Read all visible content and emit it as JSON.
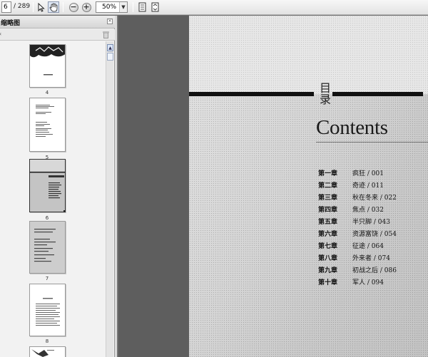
{
  "toolbar": {
    "page_current": "6",
    "page_total": "/ 289",
    "zoom": "50%",
    "icons": [
      "select-arrow-icon",
      "hand-tool-icon",
      "zoom-out-icon",
      "zoom-in-icon",
      "drop-arrow-icon",
      "single-page-icon",
      "page-fit-icon"
    ]
  },
  "panel": {
    "title": "缩略图",
    "close": "×",
    "sub_chevron": "‹"
  },
  "thumbnails": [
    {
      "num": "4"
    },
    {
      "num": "5"
    },
    {
      "num": "6"
    },
    {
      "num": "7"
    },
    {
      "num": "8"
    }
  ],
  "page": {
    "heading_cn": "目录",
    "heading_en": "Contents",
    "toc": [
      {
        "chapter": "第一章",
        "title": "疯狂 / 001"
      },
      {
        "chapter": "第二章",
        "title": "奇迹 / 011"
      },
      {
        "chapter": "第三章",
        "title": "秋在冬来 / 022"
      },
      {
        "chapter": "第四章",
        "title": "焦点 / 032"
      },
      {
        "chapter": "第五章",
        "title": "半只脚 / 043"
      },
      {
        "chapter": "第六章",
        "title": "资源富饶 / 054"
      },
      {
        "chapter": "第七章",
        "title": "征途 / 064"
      },
      {
        "chapter": "第八章",
        "title": "外来者 / 074"
      },
      {
        "chapter": "第九章",
        "title": "初战之后 / 086"
      },
      {
        "chapter": "第十章",
        "title": "军人 / 094"
      }
    ]
  }
}
